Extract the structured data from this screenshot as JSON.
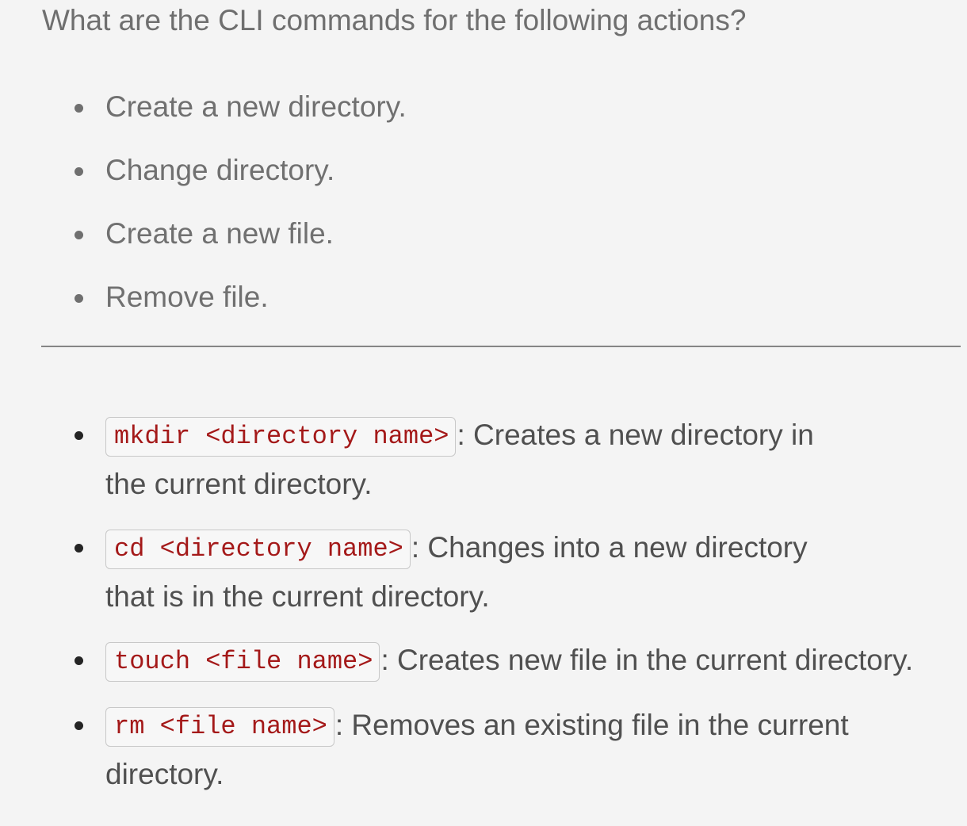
{
  "question": {
    "text": "What are the CLI commands for the following actions?"
  },
  "actions": [
    "Create a new directory.",
    "Change directory.",
    "Create a new file.",
    "Remove file."
  ],
  "answers": [
    {
      "command": "mkdir <directory name>",
      "description": ": Creates a new directory in the current directory."
    },
    {
      "command": "cd <directory name>",
      "description": ": Changes into a new directory that is in the current directory."
    },
    {
      "command": "touch <file name>",
      "description": ": Creates new file in the current directory."
    },
    {
      "command": "rm <file name>",
      "description": ": Removes an existing file in the current directory."
    }
  ],
  "colors": {
    "background": "#f4f4f4",
    "question_text": "#6f6f6f",
    "body_text": "#505050",
    "code_text": "#a41919",
    "code_border": "#c8c8c8",
    "divider": "#858585"
  }
}
